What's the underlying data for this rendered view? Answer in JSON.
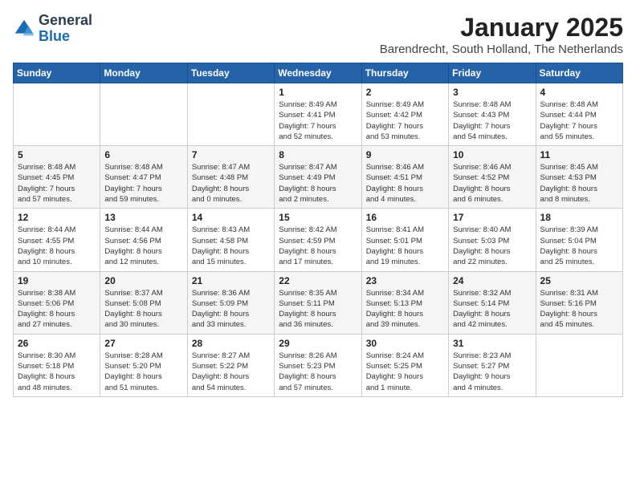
{
  "logo": {
    "general": "General",
    "blue": "Blue"
  },
  "header": {
    "title": "January 2025",
    "subtitle": "Barendrecht, South Holland, The Netherlands"
  },
  "weekdays": [
    "Sunday",
    "Monday",
    "Tuesday",
    "Wednesday",
    "Thursday",
    "Friday",
    "Saturday"
  ],
  "weeks": [
    [
      {
        "day": "",
        "info": ""
      },
      {
        "day": "",
        "info": ""
      },
      {
        "day": "",
        "info": ""
      },
      {
        "day": "1",
        "info": "Sunrise: 8:49 AM\nSunset: 4:41 PM\nDaylight: 7 hours\nand 52 minutes."
      },
      {
        "day": "2",
        "info": "Sunrise: 8:49 AM\nSunset: 4:42 PM\nDaylight: 7 hours\nand 53 minutes."
      },
      {
        "day": "3",
        "info": "Sunrise: 8:48 AM\nSunset: 4:43 PM\nDaylight: 7 hours\nand 54 minutes."
      },
      {
        "day": "4",
        "info": "Sunrise: 8:48 AM\nSunset: 4:44 PM\nDaylight: 7 hours\nand 55 minutes."
      }
    ],
    [
      {
        "day": "5",
        "info": "Sunrise: 8:48 AM\nSunset: 4:45 PM\nDaylight: 7 hours\nand 57 minutes."
      },
      {
        "day": "6",
        "info": "Sunrise: 8:48 AM\nSunset: 4:47 PM\nDaylight: 7 hours\nand 59 minutes."
      },
      {
        "day": "7",
        "info": "Sunrise: 8:47 AM\nSunset: 4:48 PM\nDaylight: 8 hours\nand 0 minutes."
      },
      {
        "day": "8",
        "info": "Sunrise: 8:47 AM\nSunset: 4:49 PM\nDaylight: 8 hours\nand 2 minutes."
      },
      {
        "day": "9",
        "info": "Sunrise: 8:46 AM\nSunset: 4:51 PM\nDaylight: 8 hours\nand 4 minutes."
      },
      {
        "day": "10",
        "info": "Sunrise: 8:46 AM\nSunset: 4:52 PM\nDaylight: 8 hours\nand 6 minutes."
      },
      {
        "day": "11",
        "info": "Sunrise: 8:45 AM\nSunset: 4:53 PM\nDaylight: 8 hours\nand 8 minutes."
      }
    ],
    [
      {
        "day": "12",
        "info": "Sunrise: 8:44 AM\nSunset: 4:55 PM\nDaylight: 8 hours\nand 10 minutes."
      },
      {
        "day": "13",
        "info": "Sunrise: 8:44 AM\nSunset: 4:56 PM\nDaylight: 8 hours\nand 12 minutes."
      },
      {
        "day": "14",
        "info": "Sunrise: 8:43 AM\nSunset: 4:58 PM\nDaylight: 8 hours\nand 15 minutes."
      },
      {
        "day": "15",
        "info": "Sunrise: 8:42 AM\nSunset: 4:59 PM\nDaylight: 8 hours\nand 17 minutes."
      },
      {
        "day": "16",
        "info": "Sunrise: 8:41 AM\nSunset: 5:01 PM\nDaylight: 8 hours\nand 19 minutes."
      },
      {
        "day": "17",
        "info": "Sunrise: 8:40 AM\nSunset: 5:03 PM\nDaylight: 8 hours\nand 22 minutes."
      },
      {
        "day": "18",
        "info": "Sunrise: 8:39 AM\nSunset: 5:04 PM\nDaylight: 8 hours\nand 25 minutes."
      }
    ],
    [
      {
        "day": "19",
        "info": "Sunrise: 8:38 AM\nSunset: 5:06 PM\nDaylight: 8 hours\nand 27 minutes."
      },
      {
        "day": "20",
        "info": "Sunrise: 8:37 AM\nSunset: 5:08 PM\nDaylight: 8 hours\nand 30 minutes."
      },
      {
        "day": "21",
        "info": "Sunrise: 8:36 AM\nSunset: 5:09 PM\nDaylight: 8 hours\nand 33 minutes."
      },
      {
        "day": "22",
        "info": "Sunrise: 8:35 AM\nSunset: 5:11 PM\nDaylight: 8 hours\nand 36 minutes."
      },
      {
        "day": "23",
        "info": "Sunrise: 8:34 AM\nSunset: 5:13 PM\nDaylight: 8 hours\nand 39 minutes."
      },
      {
        "day": "24",
        "info": "Sunrise: 8:32 AM\nSunset: 5:14 PM\nDaylight: 8 hours\nand 42 minutes."
      },
      {
        "day": "25",
        "info": "Sunrise: 8:31 AM\nSunset: 5:16 PM\nDaylight: 8 hours\nand 45 minutes."
      }
    ],
    [
      {
        "day": "26",
        "info": "Sunrise: 8:30 AM\nSunset: 5:18 PM\nDaylight: 8 hours\nand 48 minutes."
      },
      {
        "day": "27",
        "info": "Sunrise: 8:28 AM\nSunset: 5:20 PM\nDaylight: 8 hours\nand 51 minutes."
      },
      {
        "day": "28",
        "info": "Sunrise: 8:27 AM\nSunset: 5:22 PM\nDaylight: 8 hours\nand 54 minutes."
      },
      {
        "day": "29",
        "info": "Sunrise: 8:26 AM\nSunset: 5:23 PM\nDaylight: 8 hours\nand 57 minutes."
      },
      {
        "day": "30",
        "info": "Sunrise: 8:24 AM\nSunset: 5:25 PM\nDaylight: 9 hours\nand 1 minute."
      },
      {
        "day": "31",
        "info": "Sunrise: 8:23 AM\nSunset: 5:27 PM\nDaylight: 9 hours\nand 4 minutes."
      },
      {
        "day": "",
        "info": ""
      }
    ]
  ]
}
